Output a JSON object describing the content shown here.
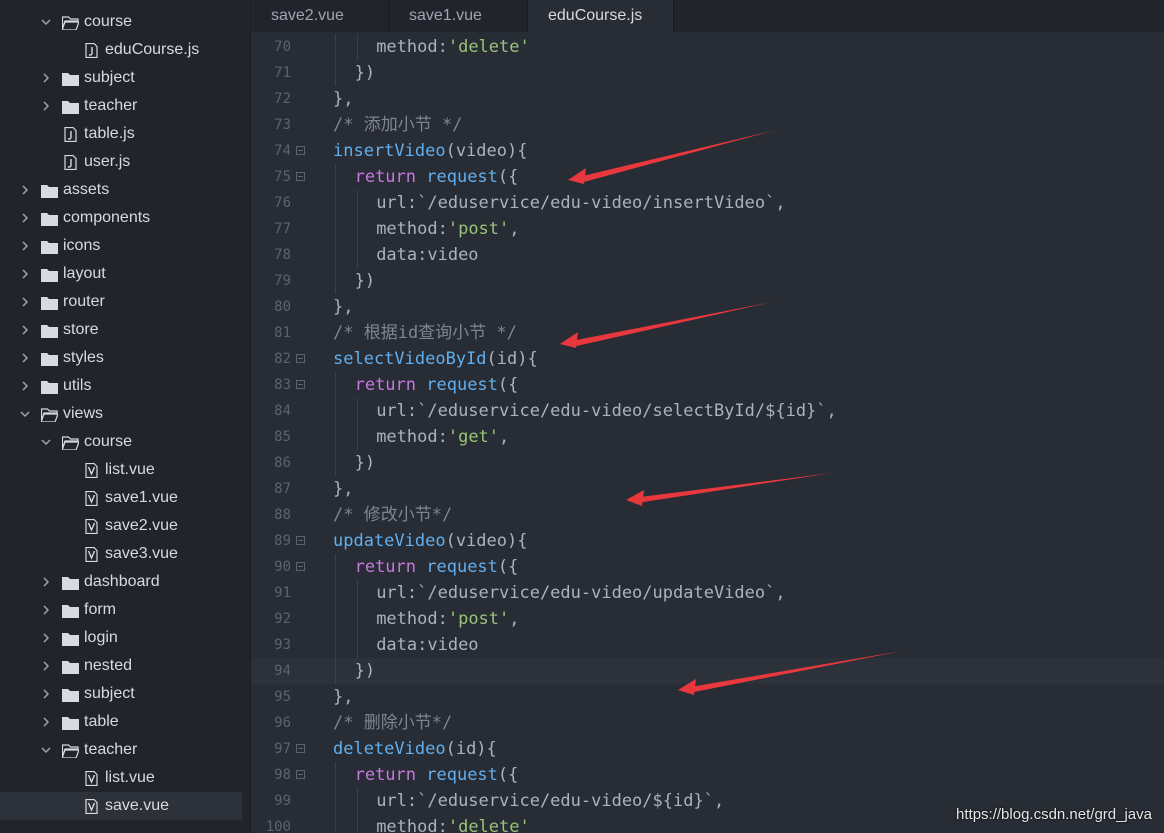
{
  "sidebar": {
    "items": [
      {
        "label": "course",
        "type": "folder-open",
        "indent": 3
      },
      {
        "label": "eduCourse.js",
        "type": "file-js",
        "indent": 4
      },
      {
        "label": "subject",
        "type": "folder",
        "indent": 3
      },
      {
        "label": "teacher",
        "type": "folder",
        "indent": 3
      },
      {
        "label": "table.js",
        "type": "file-js",
        "indent": 3
      },
      {
        "label": "user.js",
        "type": "file-js",
        "indent": 3
      },
      {
        "label": "assets",
        "type": "folder",
        "indent": 2
      },
      {
        "label": "components",
        "type": "folder",
        "indent": 2
      },
      {
        "label": "icons",
        "type": "folder",
        "indent": 2
      },
      {
        "label": "layout",
        "type": "folder",
        "indent": 2
      },
      {
        "label": "router",
        "type": "folder",
        "indent": 2
      },
      {
        "label": "store",
        "type": "folder",
        "indent": 2
      },
      {
        "label": "styles",
        "type": "folder",
        "indent": 2
      },
      {
        "label": "utils",
        "type": "folder",
        "indent": 2
      },
      {
        "label": "views",
        "type": "folder-open",
        "indent": 2
      },
      {
        "label": "course",
        "type": "folder-open",
        "indent": 3
      },
      {
        "label": "list.vue",
        "type": "file-vue",
        "indent": 4
      },
      {
        "label": "save1.vue",
        "type": "file-vue",
        "indent": 4
      },
      {
        "label": "save2.vue",
        "type": "file-vue",
        "indent": 4
      },
      {
        "label": "save3.vue",
        "type": "file-vue",
        "indent": 4
      },
      {
        "label": "dashboard",
        "type": "folder",
        "indent": 3
      },
      {
        "label": "form",
        "type": "folder",
        "indent": 3
      },
      {
        "label": "login",
        "type": "folder",
        "indent": 3
      },
      {
        "label": "nested",
        "type": "folder",
        "indent": 3
      },
      {
        "label": "subject",
        "type": "folder",
        "indent": 3
      },
      {
        "label": "table",
        "type": "folder",
        "indent": 3
      },
      {
        "label": "teacher",
        "type": "folder-open",
        "indent": 3
      },
      {
        "label": "list.vue",
        "type": "file-vue",
        "indent": 4
      },
      {
        "label": "save.vue",
        "type": "file-vue",
        "indent": 4,
        "selected": true
      }
    ]
  },
  "tabs": [
    {
      "label": "save2.vue",
      "active": false
    },
    {
      "label": "save1.vue",
      "active": false
    },
    {
      "label": "eduCourse.js",
      "active": true
    }
  ],
  "editor": {
    "current_line": "94",
    "lines": [
      {
        "n": "70",
        "fold": false,
        "indent": 2,
        "tokens": [
          [
            "pl",
            "method:"
          ],
          [
            "str",
            "'delete'"
          ]
        ]
      },
      {
        "n": "71",
        "fold": false,
        "indent": 1,
        "tokens": [
          [
            "pl",
            "})"
          ]
        ]
      },
      {
        "n": "72",
        "fold": false,
        "indent": 0,
        "tokens": [
          [
            "pl",
            "},"
          ]
        ]
      },
      {
        "n": "73",
        "fold": false,
        "indent": 0,
        "tokens": [
          [
            "cmt",
            "/* 添加小节 */"
          ]
        ]
      },
      {
        "n": "74",
        "fold": true,
        "indent": 0,
        "tokens": [
          [
            "fn",
            "insertVideo"
          ],
          [
            "pl",
            "(video){"
          ]
        ]
      },
      {
        "n": "75",
        "fold": true,
        "indent": 1,
        "tokens": [
          [
            "kw",
            "return "
          ],
          [
            "fn",
            "request"
          ],
          [
            "pl",
            "({"
          ]
        ]
      },
      {
        "n": "76",
        "fold": false,
        "indent": 2,
        "tokens": [
          [
            "pl",
            "url:`/eduservice/edu-video/insertVideo`,"
          ]
        ]
      },
      {
        "n": "77",
        "fold": false,
        "indent": 2,
        "tokens": [
          [
            "pl",
            "method:"
          ],
          [
            "str",
            "'post'"
          ],
          [
            "pl",
            ","
          ]
        ]
      },
      {
        "n": "78",
        "fold": false,
        "indent": 2,
        "tokens": [
          [
            "pl",
            "data:video"
          ]
        ]
      },
      {
        "n": "79",
        "fold": false,
        "indent": 1,
        "tokens": [
          [
            "pl",
            "})"
          ]
        ]
      },
      {
        "n": "80",
        "fold": false,
        "indent": 0,
        "tokens": [
          [
            "pl",
            "},"
          ]
        ]
      },
      {
        "n": "81",
        "fold": false,
        "indent": 0,
        "tokens": [
          [
            "cmt",
            "/* 根据id查询小节 */"
          ]
        ]
      },
      {
        "n": "82",
        "fold": true,
        "indent": 0,
        "tokens": [
          [
            "fn",
            "selectVideoById"
          ],
          [
            "pl",
            "(id){"
          ]
        ]
      },
      {
        "n": "83",
        "fold": true,
        "indent": 1,
        "tokens": [
          [
            "kw",
            "return "
          ],
          [
            "fn",
            "request"
          ],
          [
            "pl",
            "({"
          ]
        ]
      },
      {
        "n": "84",
        "fold": false,
        "indent": 2,
        "tokens": [
          [
            "pl",
            "url:`/eduservice/edu-video/selectById/${id}`,"
          ]
        ]
      },
      {
        "n": "85",
        "fold": false,
        "indent": 2,
        "tokens": [
          [
            "pl",
            "method:"
          ],
          [
            "str",
            "'get'"
          ],
          [
            "pl",
            ","
          ]
        ]
      },
      {
        "n": "86",
        "fold": false,
        "indent": 1,
        "tokens": [
          [
            "pl",
            "})"
          ]
        ]
      },
      {
        "n": "87",
        "fold": false,
        "indent": 0,
        "tokens": [
          [
            "pl",
            "},"
          ]
        ]
      },
      {
        "n": "88",
        "fold": false,
        "indent": 0,
        "tokens": [
          [
            "cmt",
            "/* 修改小节*/"
          ]
        ]
      },
      {
        "n": "89",
        "fold": true,
        "indent": 0,
        "tokens": [
          [
            "fn",
            "updateVideo"
          ],
          [
            "pl",
            "(video){"
          ]
        ]
      },
      {
        "n": "90",
        "fold": true,
        "indent": 1,
        "tokens": [
          [
            "kw",
            "return "
          ],
          [
            "fn",
            "request"
          ],
          [
            "pl",
            "({"
          ]
        ]
      },
      {
        "n": "91",
        "fold": false,
        "indent": 2,
        "tokens": [
          [
            "pl",
            "url:`/eduservice/edu-video/updateVideo`,"
          ]
        ]
      },
      {
        "n": "92",
        "fold": false,
        "indent": 2,
        "tokens": [
          [
            "pl",
            "method:"
          ],
          [
            "str",
            "'post'"
          ],
          [
            "pl",
            ","
          ]
        ]
      },
      {
        "n": "93",
        "fold": false,
        "indent": 2,
        "tokens": [
          [
            "pl",
            "data:video"
          ]
        ]
      },
      {
        "n": "94",
        "fold": false,
        "indent": 1,
        "tokens": [
          [
            "pl",
            "})"
          ]
        ]
      },
      {
        "n": "95",
        "fold": false,
        "indent": 0,
        "tokens": [
          [
            "pl",
            "},"
          ]
        ]
      },
      {
        "n": "96",
        "fold": false,
        "indent": 0,
        "tokens": [
          [
            "cmt",
            "/* 删除小节*/"
          ]
        ]
      },
      {
        "n": "97",
        "fold": true,
        "indent": 0,
        "tokens": [
          [
            "fn",
            "deleteVideo"
          ],
          [
            "pl",
            "(id){"
          ]
        ]
      },
      {
        "n": "98",
        "fold": true,
        "indent": 1,
        "tokens": [
          [
            "kw",
            "return "
          ],
          [
            "fn",
            "request"
          ],
          [
            "pl",
            "({"
          ]
        ]
      },
      {
        "n": "99",
        "fold": false,
        "indent": 2,
        "tokens": [
          [
            "pl",
            "url:`/eduservice/edu-video/${id}`,"
          ]
        ]
      },
      {
        "n": "100",
        "fold": false,
        "indent": 2,
        "tokens": [
          [
            "pl",
            "method:"
          ],
          [
            "str",
            "'delete'"
          ]
        ]
      }
    ]
  },
  "watermark": "https://blog.csdn.net/grd_java",
  "colors": {
    "function": "#61afef",
    "keyword": "#c678dd",
    "string": "#98c379",
    "comment": "#7f848e",
    "plain": "#abb2bf",
    "annotation_arrow": "#e8383d"
  }
}
